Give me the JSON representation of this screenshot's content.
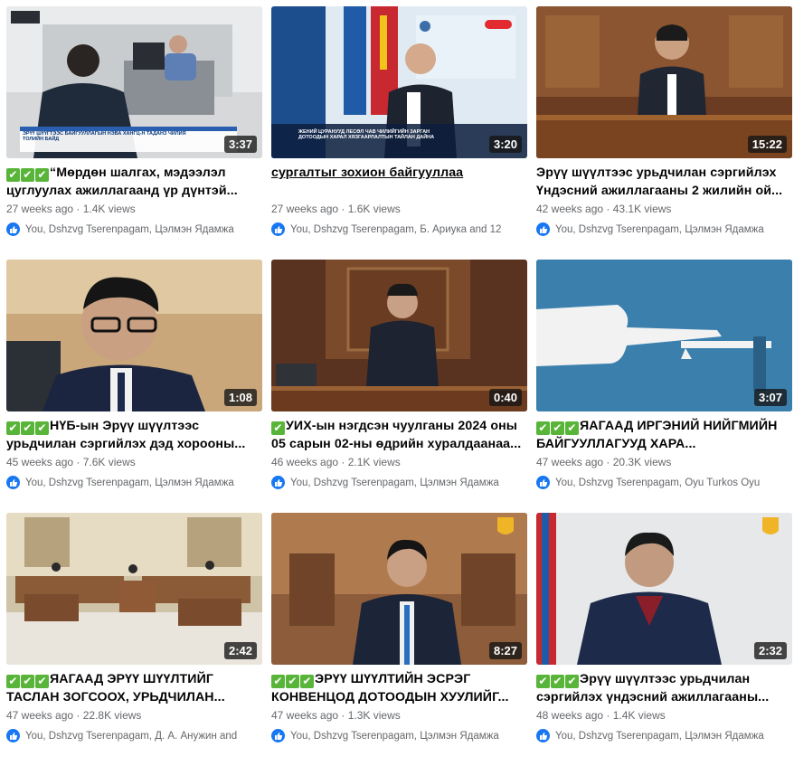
{
  "videos": [
    {
      "title_text": "“Мөрдөн шалгах, мэдээлэл цуглуулах ажиллагаанд үр дүнтэй...",
      "checks": "✔✔✔",
      "views": "27 weeks ago · 1.4K views",
      "reactors": "You, Dshzvg Tserenpagam, Цэлмэн Ядамжа",
      "duration": "3:37",
      "overlay_lines": [
        "ЭРҮҮ ШҮҮГТЭЭС БАЙГУУЛЛАГЫН НЭВА ХАНГЦ-Н ТАДАНЗ ЧИЛИЯ",
        "ТОЛИЙН БАЙД"
      ]
    },
    {
      "title_text": "сургалтыг зохион байгууллаа",
      "checks": "",
      "views": "27 weeks ago · 1.6K views",
      "reactors": "You, Dshzvg Tserenpagam, Б. Ариука and 12",
      "duration": "3:20",
      "overlay_lines": [
        "ЖЕНИЙ ЦУРАНУУД ЛЕСӨЛ ЧАВ ЧИЛИЙГИЙН ЗАРГАН",
        "ДОТООДЫН ХАРАЛ ХЯЗГААРЛАЛТЫН ТАЙЛАН ДАЙНА"
      ]
    },
    {
      "title_text": "Эрүү шүүлтээс урьдчилан сэргийлэх Үндэсний ажиллагааны 2 жилийн ой...",
      "checks": "",
      "views": "42 weeks ago · 43.1K views",
      "reactors": "You, Dshzvg Tserenpagam, Цэлмэн Ядамжа",
      "duration": "15:22"
    },
    {
      "title_text": "НҮБ-ын Эрүү шүүлтээс урьдчилан сэргийлэх дэд хорооны...",
      "checks": "✔✔✔",
      "views": "45 weeks ago · 7.6K views",
      "reactors": "You, Dshzvg Tserenpagam, Цэлмэн Ядамжа",
      "duration": "1:08"
    },
    {
      "title_text": "УИХ-ын нэгдсэн чуулганы 2024 оны 05 сарын 02-ны өдрийн хуралдаанаа...",
      "checks": "✔",
      "views": "46 weeks ago · 2.1K views",
      "reactors": "You, Dshzvg Tserenpagam, Цэлмэн Ядамжа",
      "duration": "0:40"
    },
    {
      "title_text": "ЯАГААД ИРГЭНИЙ НИЙГМИЙН БАЙГУУЛЛАГУУД ХАРА...",
      "checks": "✔✔✔",
      "views": "47 weeks ago · 20.3K views",
      "reactors": "You, Dshzvg Tserenpagam, Oyu Turkos Oyu",
      "duration": "3:07"
    },
    {
      "title_text": "ЯАГААД ЭРҮҮ ШҮҮЛТИЙГ ТАСЛАН ЗОГСООХ, УРЬДЧИЛАН...",
      "checks": "✔✔✔",
      "views": "47 weeks ago · 22.8K views",
      "reactors": "You, Dshzvg Tserenpagam, Д. А. Анужин and",
      "duration": "2:42"
    },
    {
      "title_text": "ЭРҮҮ ШҮҮЛТИЙН ЭСРЭГ КОНВЕНЦОД ДОТООДЫН ХУУЛИЙГ...",
      "checks": "✔✔✔",
      "views": "47 weeks ago · 1.3K views",
      "reactors": "You, Dshzvg Tserenpagam, Цэлмэн Ядамжа",
      "duration": "8:27"
    },
    {
      "title_text": "Эрүү шүүлтээс урьдчилан сэргийлэх үндэсний ажиллагааны...",
      "checks": "✔✔✔",
      "views": "48 weeks ago · 1.4K views",
      "reactors": "You, Dshzvg Tserenpagam, Цэлмэн Ядамжа",
      "duration": "2:32"
    }
  ],
  "colors": {
    "check_green": "#59b53a",
    "like_blue": "#1877f2",
    "meta_gray": "#65676b"
  },
  "icons": {
    "check": "check-icon",
    "reaction": "like-icon"
  }
}
